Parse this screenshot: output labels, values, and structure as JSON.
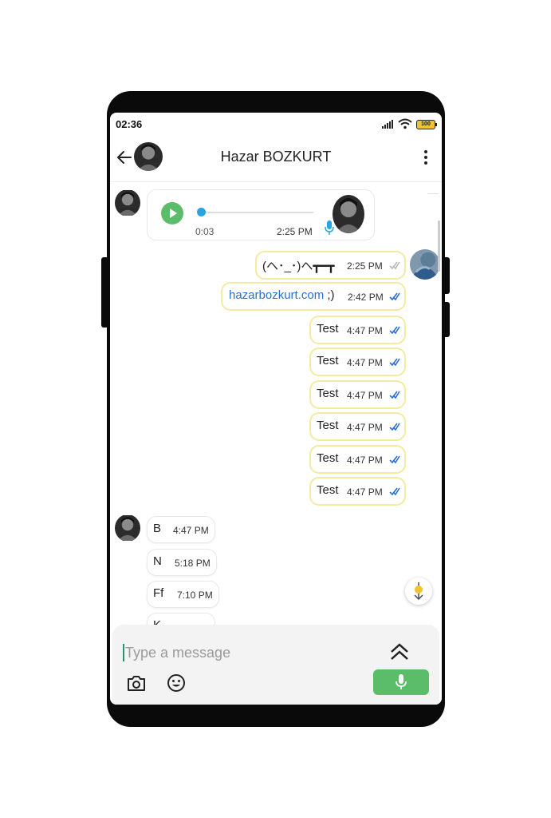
{
  "status_bar": {
    "time": "02:36",
    "battery": "100"
  },
  "header": {
    "title": "Hazar BOZKURT"
  },
  "voice_message": {
    "duration": "0:03",
    "time": "2:25 PM"
  },
  "outgoing_messages": [
    {
      "text": "(ヘ･_･)ヘ┳━┳",
      "time": "2:25 PM"
    },
    {
      "link": "hazarbozkurt.com",
      "text": " ;)",
      "time": "2:42 PM"
    },
    {
      "text": "Test",
      "time": "4:47 PM"
    },
    {
      "text": "Test",
      "time": "4:47 PM"
    },
    {
      "text": "Test",
      "time": "4:47 PM"
    },
    {
      "text": "Test",
      "time": "4:47 PM"
    },
    {
      "text": "Test",
      "time": "4:47 PM"
    },
    {
      "text": "Test",
      "time": "4:47 PM"
    }
  ],
  "incoming_messages": [
    {
      "text": "B",
      "time": "4:47 PM"
    },
    {
      "text": "N",
      "time": "5:18 PM"
    },
    {
      "text": "Ff",
      "time": "7:10 PM"
    },
    {
      "text": "K",
      "time": ""
    }
  ],
  "composer": {
    "placeholder": "Type a message"
  },
  "colors": {
    "accent_green": "#5bbd6a",
    "outgoing_border": "#f4eba0",
    "link": "#2b6fd4",
    "seek_knob": "#29a4e0"
  },
  "icons": [
    "back-arrow-icon",
    "more-vert-icon",
    "play-icon",
    "mic-icon",
    "double-check-icon",
    "scroll-down-icon",
    "expand-up-icon",
    "camera-icon",
    "emoji-icon"
  ]
}
